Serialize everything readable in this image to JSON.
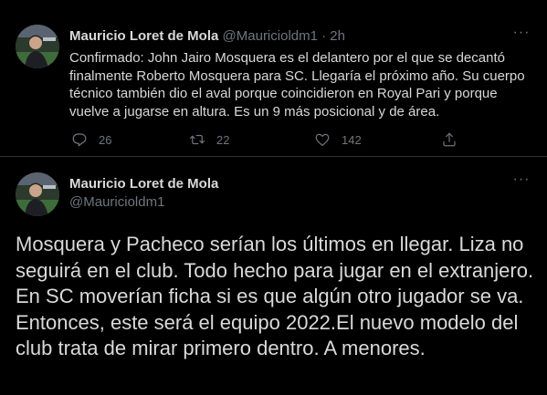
{
  "tweets": [
    {
      "author_name": "Mauricio Loret de Mola",
      "handle": "@Mauricioldm1",
      "separator": "·",
      "time": "2h",
      "text": "Confirmado: John Jairo Mosquera es el delantero por el que se decantó finalmente Roberto Mosquera para SC. Llegaría el próximo año. Su cuerpo técnico también dio el aval porque coincidieron en Royal Pari y porque vuelve a jugarse en altura. Es un 9 más posicional y de área.",
      "more_icon": "more-horizontal-icon",
      "actions": {
        "reply": {
          "icon": "reply-icon",
          "count": "26"
        },
        "retweet": {
          "icon": "retweet-icon",
          "count": "22"
        },
        "like": {
          "icon": "heart-icon",
          "count": "142"
        },
        "share": {
          "icon": "share-icon",
          "count": ""
        }
      }
    },
    {
      "author_name": "Mauricio Loret de Mola",
      "handle": "@Mauricioldm1",
      "more_icon": "more-horizontal-icon",
      "text": "Mosquera y Pacheco serían los últimos en llegar. Liza no seguirá en el club. Todo hecho para jugar en el extranjero. En SC moverían ficha si es que algún otro jugador se va. Entonces, este será el equipo 2022.El nuevo modelo del club trata de mirar primero dentro. A menores."
    }
  ],
  "colors": {
    "background": "#000000",
    "text_primary": "#d9d9d9",
    "text_secondary": "#6e767d",
    "divider": "#2f3336"
  }
}
